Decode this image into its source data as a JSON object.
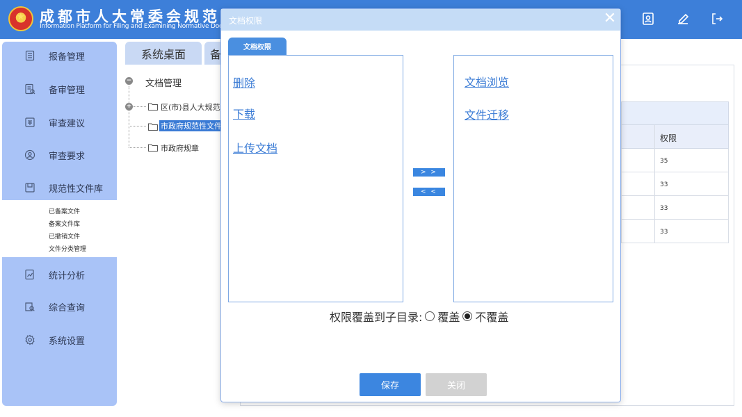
{
  "header": {
    "title_cn": "成都市人大常委会规范性",
    "title_en": "Information Platform for Filing and Examining Normative Documents",
    "icons": [
      "contact-card-icon",
      "edit-icon",
      "logout-icon"
    ]
  },
  "sidebar": {
    "items": [
      {
        "label": "报备管理",
        "icon": "document-list-icon"
      },
      {
        "label": "备审管理",
        "icon": "review-icon"
      },
      {
        "label": "审查建议",
        "icon": "suggestion-icon"
      },
      {
        "label": "审查要求",
        "icon": "user-circle-icon"
      },
      {
        "label": "规范性文件库",
        "icon": "archive-icon"
      },
      {
        "label": "统计分析",
        "icon": "chart-icon"
      },
      {
        "label": "综合查询",
        "icon": "search-doc-icon"
      },
      {
        "label": "系统设置",
        "icon": "gear-icon"
      }
    ],
    "submenu": [
      "已备案文件",
      "备案文件库",
      "已撤销文件",
      "文件分类管理"
    ]
  },
  "tabs": {
    "desktop": "系统桌面",
    "second": "备"
  },
  "tree": {
    "root": "文档管理",
    "children": [
      "区(市)县人大规范性",
      "市政府规范性文件",
      "市政府规章"
    ]
  },
  "background_table": {
    "column": "权限",
    "values": [
      "35",
      "33",
      "33",
      "33"
    ]
  },
  "modal": {
    "title": "文档权限",
    "tab": "文档权限",
    "left_items": [
      "删除",
      "下载",
      "上传文档"
    ],
    "right_items": [
      "文档浏览",
      "文件迁移"
    ],
    "move_right": "> >",
    "move_left": "< <",
    "override_label": "权限覆盖到子目录:",
    "option_override": "覆盖",
    "option_no_override": "不覆盖",
    "selected_option": "不覆盖",
    "save": "保存",
    "close": "关闭"
  }
}
